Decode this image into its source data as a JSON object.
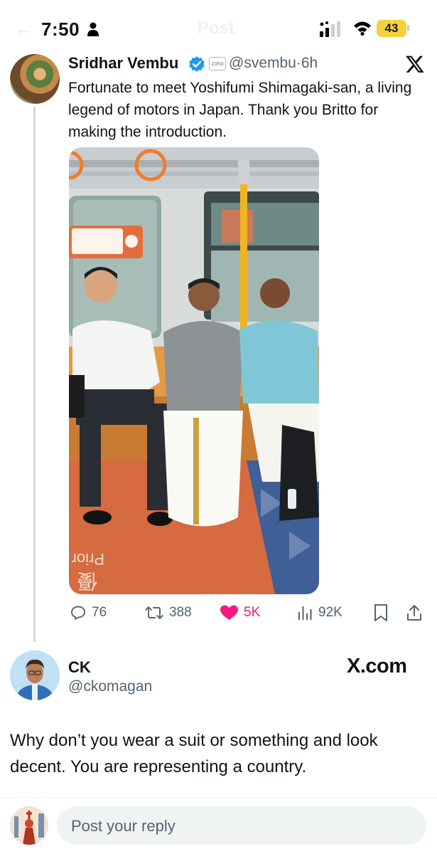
{
  "status_bar": {
    "time": "7:50",
    "battery": "43"
  },
  "header": {
    "title_ghost": "Post"
  },
  "tweet": {
    "author_name": "Sridhar Vembu",
    "handle": "@svembu",
    "age": "6h",
    "affiliate_badge": "zoho",
    "text": "Fortunate to meet Yoshifumi Shimagaki-san, a living legend of motors in Japan. Thank you Britto for making the introduction.",
    "photo_floor_text": "Prior",
    "photo_floor_kanji": "優",
    "actions": {
      "replies": "76",
      "reposts": "388",
      "likes": "5K",
      "views": "92K"
    },
    "colors": {
      "like": "#f91880",
      "verified": "#1d9bf0",
      "muted": "#536471"
    }
  },
  "reply": {
    "author_name": "CK",
    "handle": "@ckomagan",
    "watermark": "X.com",
    "text": "Why don’t you wear a suit or something and look decent. You are representing a country."
  },
  "composer": {
    "placeholder": "Post your reply"
  }
}
